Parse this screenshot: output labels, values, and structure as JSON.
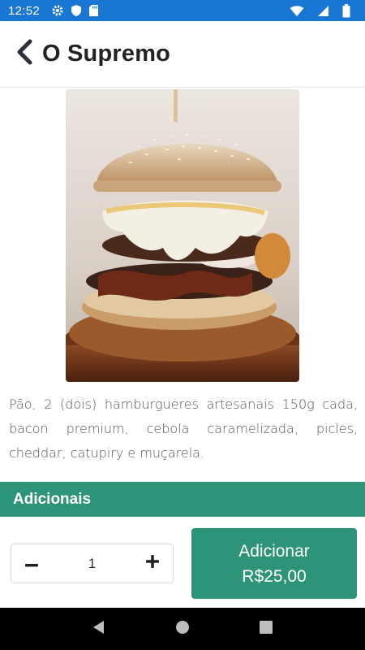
{
  "status_bar": {
    "time": "12:52",
    "left_icons": [
      "gear-icon",
      "shield-icon",
      "sd-card-icon"
    ],
    "right_icons": [
      "wifi-icon",
      "signal-icon",
      "battery-icon"
    ],
    "color": "#1976d2"
  },
  "header": {
    "title": "O Supremo",
    "back_icon": "chevron-left-icon"
  },
  "product": {
    "image_alt": "burger-photo",
    "description": "Pão, 2 (dois) hamburgueres artesanais 150g cada, bacon premium, cebola caramelizada, picles, cheddar, catupiry e muçarela."
  },
  "sections": {
    "adicionais_label": "Adicionais"
  },
  "order": {
    "quantity": "1",
    "decrement_icon": "minus-icon",
    "increment_icon": "plus-icon",
    "add_label": "Adicionar",
    "price": "R$25,00"
  },
  "nav_bar": {
    "icons": [
      "back-nav-icon",
      "home-nav-icon",
      "recents-nav-icon"
    ]
  },
  "colors": {
    "accent": "#2e9479",
    "status_bar": "#1976d2"
  }
}
